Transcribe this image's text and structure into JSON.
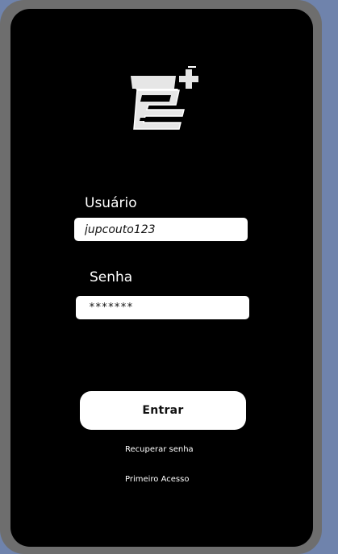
{
  "login": {
    "user_label": "Usuário",
    "user_value": "jupcouto123",
    "password_label": "Senha",
    "password_value": "*******",
    "enter_label": "Entrar",
    "recover_password_label": "Recuperar senha",
    "first_access_label": "Primeiro Acesso"
  },
  "icons": {
    "logo": "e-plus-logo"
  },
  "colors": {
    "page_background": "#6f83ac",
    "frame": "#6e6e6e",
    "screen": "#000000",
    "field": "#ffffff",
    "text_light": "#ffffff"
  }
}
